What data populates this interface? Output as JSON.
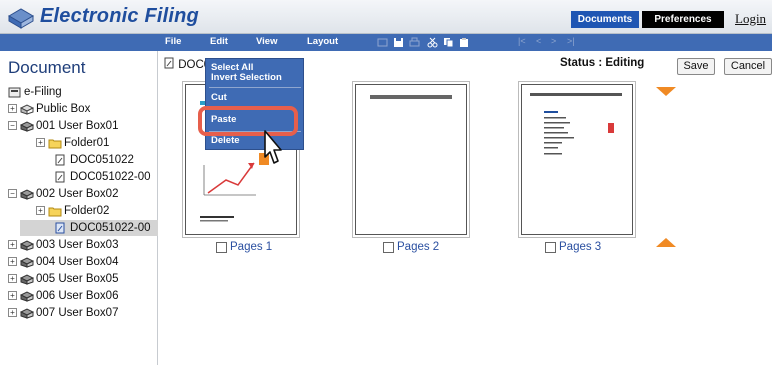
{
  "header": {
    "app_title": "Electronic Filing",
    "documents_label": "Documents",
    "preferences_label": "Preferences",
    "login_label": "Login"
  },
  "menubar": {
    "items": [
      "File",
      "Edit",
      "View",
      "Layout"
    ],
    "toolbar_icons": [
      "view-icon",
      "save-icon",
      "print-icon",
      "cut-icon",
      "copy-icon",
      "paste-icon"
    ],
    "nav_arrows": [
      "|<",
      "<",
      ">",
      ">|"
    ]
  },
  "left_pane": {
    "title": "Document",
    "tree": [
      {
        "label": "e-Filing",
        "icon": "efiling-icon"
      },
      {
        "label": "Public Box",
        "icon": "box-icon",
        "expander": "+"
      },
      {
        "label": "001 User Box01",
        "icon": "userbox-icon",
        "expander": "−"
      },
      {
        "label": "Folder01",
        "icon": "folder-icon",
        "expander": "+"
      },
      {
        "label": "DOC051022",
        "icon": "document-icon"
      },
      {
        "label": "DOC051022-00",
        "icon": "document-icon"
      },
      {
        "label": "002 User Box02",
        "icon": "userbox-icon",
        "expander": "−"
      },
      {
        "label": "Folder02",
        "icon": "folder-icon",
        "expander": "+"
      },
      {
        "label": "DOC051022-00",
        "icon": "document-icon",
        "selected": true
      },
      {
        "label": "003 User Box03",
        "icon": "userbox-icon",
        "expander": "+"
      },
      {
        "label": "004 User Box04",
        "icon": "userbox-icon",
        "expander": "+"
      },
      {
        "label": "005 User Box05",
        "icon": "userbox-icon",
        "expander": "+"
      },
      {
        "label": "006 User Box06",
        "icon": "userbox-icon",
        "expander": "+"
      },
      {
        "label": "007 User Box07",
        "icon": "userbox-icon",
        "expander": "+"
      }
    ]
  },
  "main": {
    "path_label": "DOC0",
    "status": "Status : Editing",
    "save_label": "Save",
    "cancel_label": "Cancel",
    "pages": [
      {
        "label": "Pages 1"
      },
      {
        "label": "Pages 2"
      },
      {
        "label": "Pages 3"
      }
    ]
  },
  "context_menu": {
    "items": [
      "Select All",
      "Invert Selection",
      "Cut",
      "Paste",
      "Delete"
    ],
    "highlighted": "Paste"
  },
  "colors": {
    "menu_bg": "#3f6bb4",
    "brand": "#1f4e9e",
    "highlight_ring": "#e65f4c",
    "nav_arrow": "#f08a24"
  }
}
